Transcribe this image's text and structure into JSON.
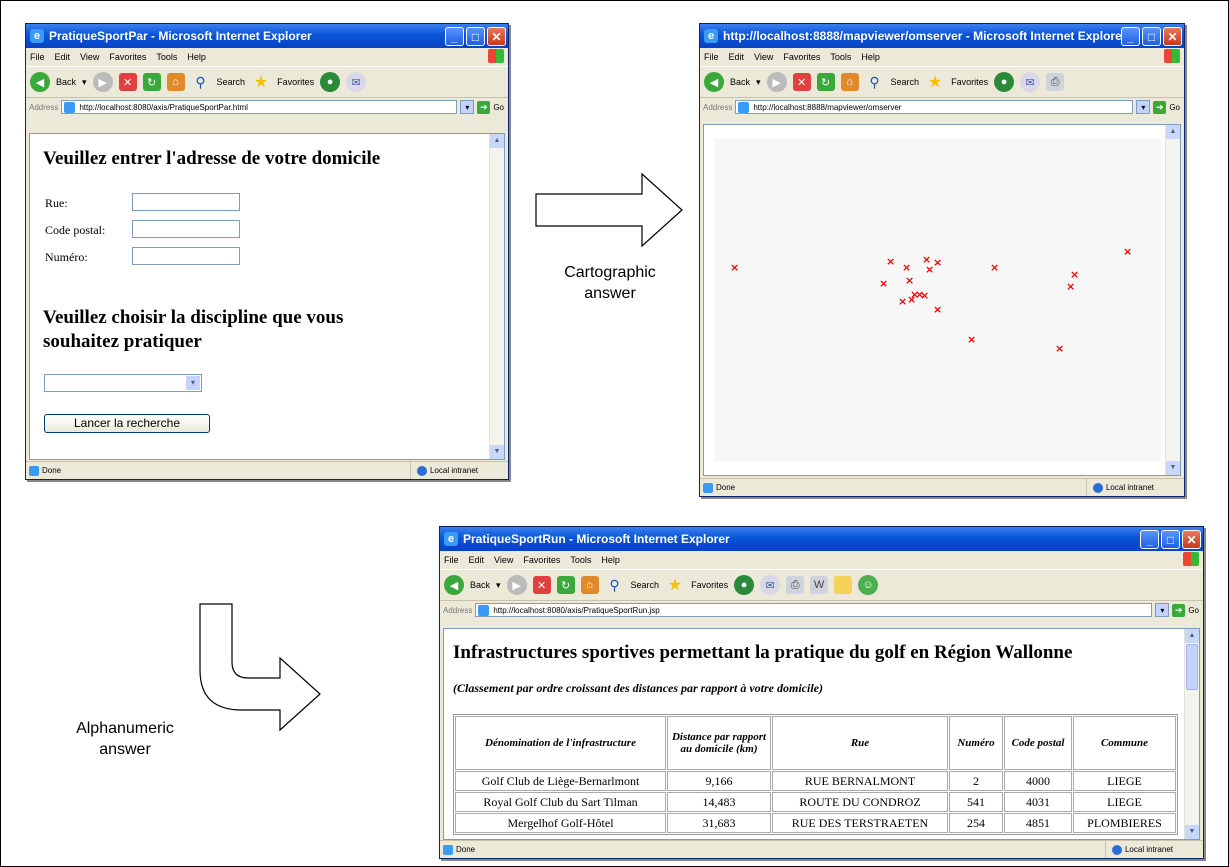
{
  "captions": {
    "carto_line1": "Cartographic",
    "carto_line2": "answer",
    "alpha_line1": "Alphanumeric",
    "alpha_line2": "answer"
  },
  "menu": [
    "File",
    "Edit",
    "View",
    "Favorites",
    "Tools",
    "Help"
  ],
  "toolbar": {
    "back": "Back",
    "search": "Search",
    "favorites": "Favorites"
  },
  "address_label": "Address",
  "go_label": "Go",
  "status_done": "Done",
  "status_zone": "Local intranet",
  "window1": {
    "title": "PratiqueSportPar - Microsoft Internet Explorer",
    "url": "http://localhost:8080/axis/PratiqueSportPar.html",
    "heading1": "Veuillez entrer l'adresse de votre domicile",
    "rue_label": "Rue:",
    "code_label": "Code postal:",
    "numero_label": "Numéro:",
    "heading2_line1": "Veuillez choisir la discipline que vous",
    "heading2_line2": "souhaitez pratiquer",
    "select_value": "",
    "search_button": "Lancer la recherche"
  },
  "window2": {
    "title": "http://localhost:8888/mapviewer/omserver - Microsoft Internet Explorer",
    "url": "http://localhost:8888/mapviewer/omserver",
    "marker_color": "#e00000",
    "marker_count": 20
  },
  "window3": {
    "title": "PratiqueSportRun - Microsoft Internet Explorer",
    "url": "http://localhost:8080/axis/PratiqueSportRun.jsp",
    "heading": "Infrastructures sportives permettant la pratique du golf en Région Wallonne",
    "subheading": "(Classement par ordre croissant des distances par rapport à votre domicile)",
    "columns": [
      "Dénomination de l'infrastructure",
      "Distance par rapport au domicile (km)",
      "Rue",
      "Numéro",
      "Code postal",
      "Commune"
    ],
    "rows": [
      [
        "Golf Club de Liège-Bernarlmont",
        "9,166",
        "RUE BERNALMONT",
        "2",
        "4000",
        "LIEGE"
      ],
      [
        "Royal Golf Club du Sart Tilman",
        "14,483",
        "ROUTE DU CONDROZ",
        "541",
        "4031",
        "LIEGE"
      ],
      [
        "Mergelhof Golf-Hôtel",
        "31,683",
        "RUE DES TERSTRAETEN",
        "254",
        "4851",
        "PLOMBIERES"
      ]
    ]
  }
}
